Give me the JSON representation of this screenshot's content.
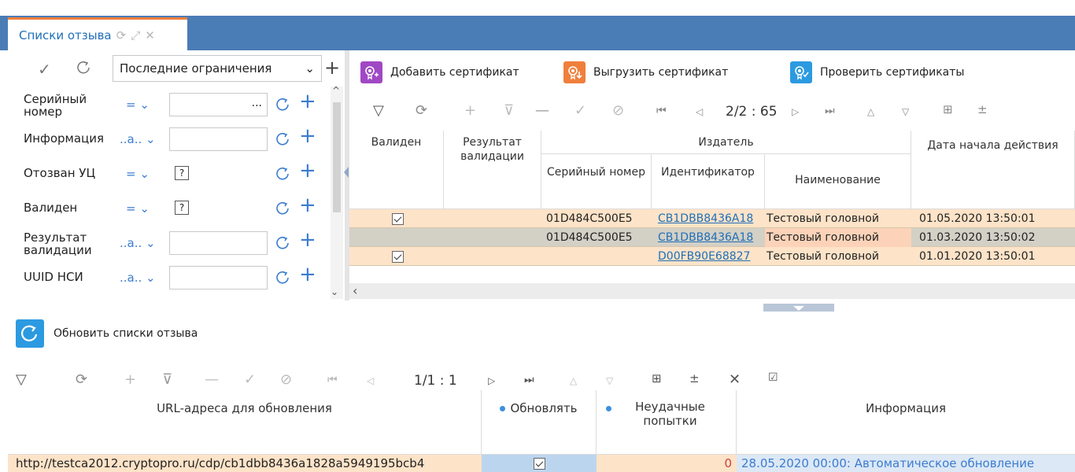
{
  "tab": {
    "title": "Списки отзыва"
  },
  "filter": {
    "preset": "Последние ограничения",
    "rows": [
      {
        "label": "Серийный номер",
        "op": "=",
        "value": "..."
      },
      {
        "label": "Информация",
        "op": "..a..",
        "value": ""
      },
      {
        "label": "Отозван УЦ",
        "op": "=",
        "value": "?"
      },
      {
        "label": "Валиден",
        "op": "=",
        "value": "?"
      },
      {
        "label": "Результат валидации",
        "op": "..a..",
        "value": ""
      },
      {
        "label": "UUID НСИ",
        "op": "..a..",
        "value": ""
      }
    ]
  },
  "actions": {
    "add_cert": "Добавить сертификат",
    "export_cert": "Выгрузить сертификат",
    "verify_certs": "Проверить сертификаты"
  },
  "top_grid": {
    "pager": "2/2 : 65",
    "headers": {
      "valid": "Валиден",
      "result": "Результат валидации",
      "issuer": "Издатель",
      "serial": "Серийный номер",
      "identifier": "Идентификатор",
      "name": "Наименование",
      "start_date": "Дата начала действия"
    },
    "rows": [
      {
        "valid": true,
        "serial": "01D484C500E5",
        "identifier": "CB1DBB8436A18",
        "name": "Тестовый головной",
        "start": "01.05.2020 13:50:01"
      },
      {
        "valid": false,
        "serial": "01D484C500E5",
        "identifier": "CB1DBB8436A18",
        "name": "Тестовый головной",
        "start": "01.03.2020 13:50:02"
      },
      {
        "valid": true,
        "serial": "",
        "identifier": "D00FB90E68827",
        "name": "Тестовый головной",
        "start": "01.01.2020 13:50:01"
      }
    ]
  },
  "bottom": {
    "refresh_label": "Обновить списки отзыва",
    "pager": "1/1 : 1",
    "headers": {
      "url": "URL-адреса для обновления",
      "update": "Обновлять",
      "failed": "Неудачные попытки",
      "info": "Информация"
    },
    "row": {
      "url": "http://testca2012.cryptopro.ru/cdp/cb1dbb8436a1828a5949195bcb4",
      "update": true,
      "failed": "0",
      "info": "28.05.2020 00:00: Автоматическое обновление"
    }
  },
  "colors": {
    "tabbar": "#4a7cb6",
    "accent": "#f07f3c",
    "link": "#1f6fb8",
    "row_highlight": "#fde3c8",
    "row_selected": "#d3d0c6"
  }
}
